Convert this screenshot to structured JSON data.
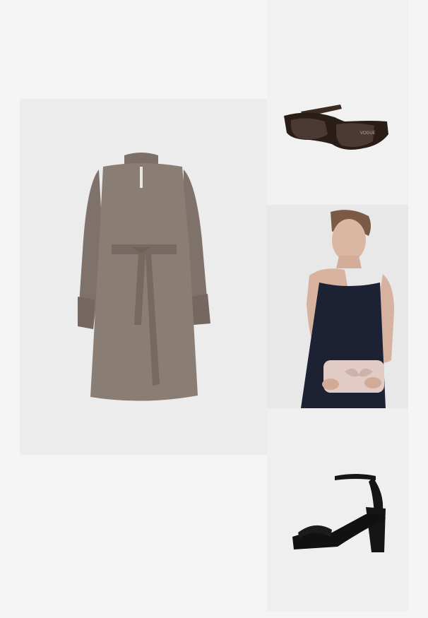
{
  "outfit": {
    "items": [
      {
        "key": "dress",
        "product": "belted-shirt-dress",
        "color": "taupe",
        "colors": {
          "base": "#8a7d74",
          "shade": "#766a62"
        }
      },
      {
        "key": "sunglasses",
        "product": "rectangle-sunglasses",
        "color": "tortoiseshell",
        "logo_text": "VOGUE",
        "colors": {
          "frame": "#2a1c16",
          "lens": "#4a3a33"
        }
      },
      {
        "key": "clutch",
        "product": "bow-clutch-bag",
        "color": "blush",
        "colors": {
          "bag": "#e2cbc5",
          "dress": "#1c2233"
        }
      },
      {
        "key": "sandals",
        "product": "platform-sandals",
        "color": "black-patent",
        "colors": {
          "shoe": "#151515"
        }
      }
    ]
  }
}
